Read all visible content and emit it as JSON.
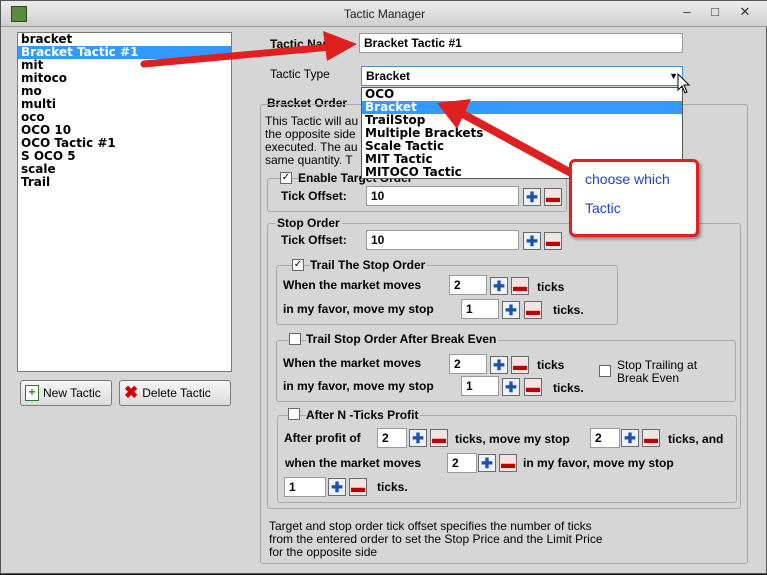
{
  "window": {
    "title": "Tactic Manager",
    "minimize": "–",
    "maximize": "□",
    "close": "✕"
  },
  "tactic_list": [
    "bracket",
    "Bracket Tactic #1",
    "mit",
    "mitoco",
    "mo",
    "multi",
    "oco",
    "OCO 10",
    "OCO Tactic #1",
    "S OCO 5",
    "scale",
    "Trail"
  ],
  "tactic_list_selected": "Bracket Tactic #1",
  "buttons": {
    "new": "New Tactic",
    "delete": "Delete Tactic"
  },
  "form": {
    "name_label": "Tactic Name",
    "name_value": "Bracket Tactic #1",
    "type_label": "Tactic Type",
    "type_value": "Bracket",
    "type_options": [
      "OCO",
      "Bracket",
      "TrailStop",
      "Multiple Brackets",
      "Scale Tactic",
      "MIT Tactic",
      "MITOCO Tactic"
    ]
  },
  "bracket": {
    "title": "Bracket Order",
    "desc_line1": "This Tactic will au",
    "desc_line2": "the opposite side",
    "desc_line3": "executed. The au",
    "desc_line4": "same quantity. T"
  },
  "target": {
    "enable_label": "Enable Target Order",
    "enabled": true,
    "offset_label": "Tick Offset:",
    "offset_value": "10"
  },
  "stop": {
    "title": "Stop Order",
    "offset_label": "Tick Offset:",
    "offset_value": "10"
  },
  "trail": {
    "label": "Trail The Stop Order",
    "checked": true,
    "moves_label": "When the market moves",
    "moves_value": "2",
    "ticks": "ticks",
    "favor_label": "in my favor, move my stop",
    "favor_value": "1",
    "ticks2": "ticks."
  },
  "breakeven": {
    "label": "Trail Stop Order After Break Even",
    "checked": false,
    "moves_label": "When the market moves",
    "moves_value": "2",
    "ticks": "ticks",
    "favor_label": "in my favor, move my stop",
    "favor_value": "1",
    "ticks2": "ticks.",
    "stop_trailing_line1": "Stop Trailing at",
    "stop_trailing_line2": "Break Even"
  },
  "nticks": {
    "label": "After N -Ticks Profit",
    "checked": false,
    "profit_label": "After profit of",
    "profit_value": "2",
    "move_label": "ticks, move my stop",
    "move_value": "2",
    "ticks_and": "ticks, and",
    "when_label": "when the market moves",
    "when_value": "2",
    "favor_label": "in my favor, move my stop",
    "last_value": "1",
    "ticks_end": "ticks."
  },
  "footer": {
    "line1": "Target and stop order tick offset specifies the number of ticks",
    "line2": "from the entered order to set the Stop Price and the Limit Price",
    "line3": "for the opposite side"
  },
  "callout": {
    "line1": "choose which",
    "line2": "Tactic"
  },
  "colors": {
    "selection": "#3399ff",
    "arrow": "#e02020",
    "callout_text": "#1e3fd0"
  }
}
